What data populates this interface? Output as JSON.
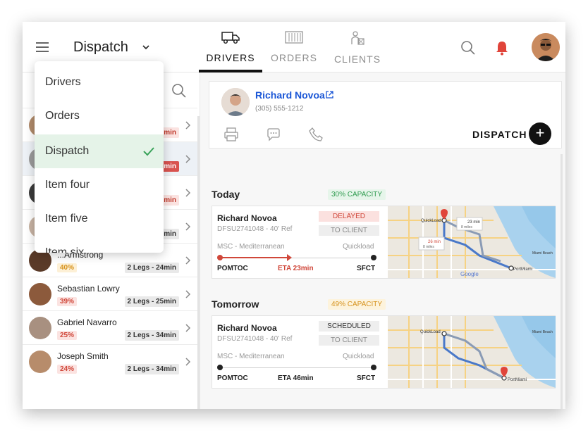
{
  "header": {
    "title": "Dispatch",
    "tabs": [
      {
        "label": "DRIVERS",
        "icon": "truck-icon",
        "active": true
      },
      {
        "label": "ORDERS",
        "icon": "container-icon",
        "active": false
      },
      {
        "label": "CLIENTS",
        "icon": "clients-icon",
        "active": false
      }
    ]
  },
  "dropdown": {
    "items": [
      "Drivers",
      "Orders",
      "Dispatch",
      "Item four",
      "Item five",
      "Item six"
    ],
    "selected": "Dispatch"
  },
  "drivers": [
    {
      "name": "",
      "pct": "",
      "legs": "min",
      "legs_style": "pink"
    },
    {
      "name": "",
      "pct": "",
      "legs": "min",
      "legs_style": "red"
    },
    {
      "name": "",
      "pct": "",
      "legs": "min",
      "legs_style": "pink"
    },
    {
      "name": "",
      "pct": "",
      "legs": "min",
      "legs_style": "gray"
    },
    {
      "name": "...Armstrong",
      "pct": "40%",
      "legs": "2 Legs - 24min",
      "legs_style": "gray"
    },
    {
      "name": "Sebastian Lowry",
      "pct": "39%",
      "legs": "2 Legs - 25min",
      "legs_style": "gray"
    },
    {
      "name": "Gabriel Navarro",
      "pct": "25%",
      "legs": "2 Legs - 34min",
      "legs_style": "gray"
    },
    {
      "name": "Joseph Smith",
      "pct": "24%",
      "legs": "2 Legs - 34min",
      "legs_style": "gray"
    }
  ],
  "profile": {
    "name": "Richard Novoa",
    "phone": "(305) 555-1212",
    "dispatch_label": "DISPATCH"
  },
  "sections": [
    {
      "title": "Today",
      "capacity": "30% CAPACITY",
      "card": {
        "driver": "Richard Novoa",
        "ref": "DFSU2741048 - 40' Ref",
        "badge1": "DELAYED",
        "badge2": "TO CLIENT",
        "route": "MSC - Mediterranean",
        "quickload": "Quickload",
        "from": "POMTOC",
        "eta": "ETA 23min",
        "to": "SFCT",
        "map_labels": [
          "QuickLoad",
          "23 min",
          "8 miles",
          "26 min",
          "8 miles",
          "PortMiami",
          "Miami Beach",
          "Google"
        ]
      }
    },
    {
      "title": "Tomorrow",
      "capacity": "49% CAPACITY",
      "card": {
        "driver": "Richard Novoa",
        "ref": "DFSU2741048 - 40' Ref",
        "badge1": "SCHEDULED",
        "badge2": "TO CLIENT",
        "route": "MSC - Mediterranean",
        "quickload": "Quickload",
        "from": "POMTOC",
        "eta": "ETA 46min",
        "to": "SFCT",
        "map_labels": [
          "QuickLoad",
          "PortMiami",
          "Miami Beach"
        ]
      }
    }
  ],
  "colors": {
    "accent_blue": "#1a56d6",
    "delayed_red": "#d0473a",
    "capacity_green": "#2e9b4e",
    "capacity_orange": "#d6921c",
    "bell_red": "#e0443a"
  }
}
